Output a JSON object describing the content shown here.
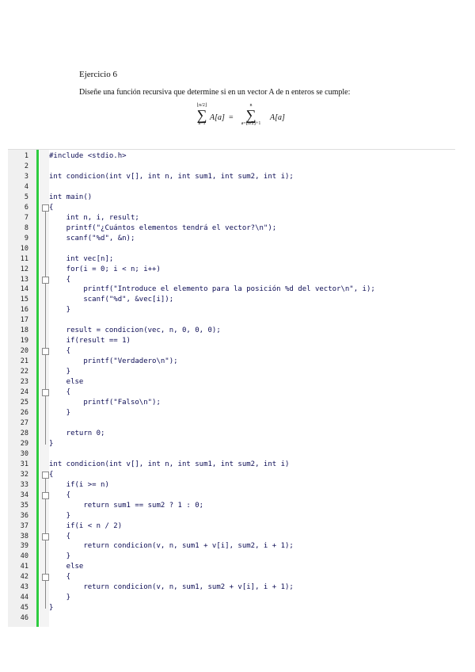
{
  "title": "Ejercicio 6",
  "paragraph": "Diseñe una función recursiva que determine si en un vector A de n enteros se cumple:",
  "formula": {
    "left_upper": "⌊n/2⌋",
    "left_lower": "a=1",
    "left_term": "A[a]",
    "equals": "=",
    "right_upper": "n",
    "right_lower": "a=⌊n/2⌋+1",
    "right_term": "A[a]",
    "sigma": "∑"
  },
  "code_lines": [
    "#include <stdio.h>",
    "",
    "int condicion(int v[], int n, int sum1, int sum2, int i);",
    "",
    "int main()",
    "{",
    "    int n, i, result;",
    "    printf(\"¿Cuántos elementos tendrá el vector?\\n\");",
    "    scanf(\"%d\", &n);",
    "",
    "    int vec[n];",
    "    for(i = 0; i < n; i++)",
    "    {",
    "        printf(\"Introduce el elemento para la posición %d del vector\\n\", i);",
    "        scanf(\"%d\", &vec[i]);",
    "    }",
    "",
    "    result = condicion(vec, n, 0, 0, 0);",
    "    if(result == 1)",
    "    {",
    "        printf(\"Verdadero\\n\");",
    "    }",
    "    else",
    "    {",
    "        printf(\"Falso\\n\");",
    "    }",
    "",
    "    return 0;",
    "}",
    "",
    "int condicion(int v[], int n, int sum1, int sum2, int i)",
    "{",
    "    if(i >= n)",
    "    {",
    "        return sum1 == sum2 ? 1 : 0;",
    "    }",
    "    if(i < n / 2)",
    "    {",
    "        return condicion(v, n, sum1 + v[i], sum2, i + 1);",
    "    }",
    "    else",
    "    {",
    "        return condicion(v, n, sum1, sum2 + v[i], i + 1);",
    "    }",
    "}",
    ""
  ]
}
